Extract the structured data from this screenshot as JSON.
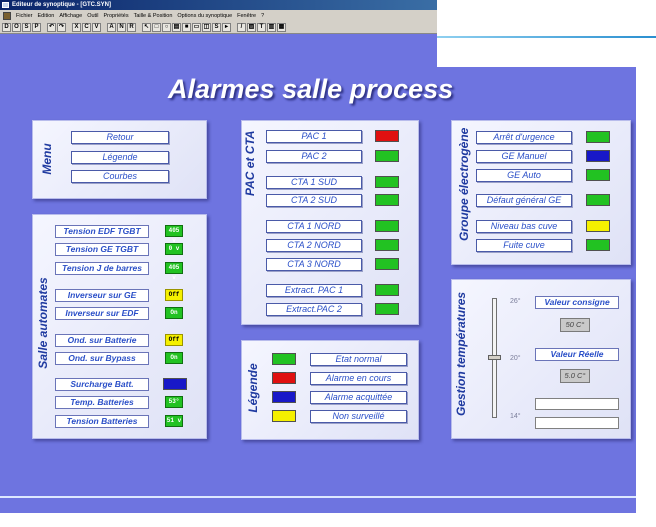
{
  "window": {
    "title": "Editeur de synoptique - [GTC.SYN]"
  },
  "menu": [
    "Fichier",
    "Edition",
    "Affichage",
    "Outil",
    "Propriétés",
    "Taille & Position",
    "Options du synoptique",
    "Fenêtre",
    "?"
  ],
  "toolbar_glyphs": [
    "D",
    "O",
    "S",
    "P",
    "",
    "↶",
    "↷",
    "",
    "X",
    "C",
    "V",
    "",
    "A",
    "N",
    "R",
    "",
    "↖",
    "□",
    "○",
    "▤",
    "■",
    "▭",
    "◫",
    "S",
    "▸",
    "",
    "/",
    "▨",
    "T",
    "▥",
    "▦"
  ],
  "page_title": "Alarmes salle process",
  "colors": {
    "green": "#22c222",
    "red": "#e01010",
    "blue": "#1818c8",
    "yellow": "#f5f000",
    "background": "#6e74e0"
  },
  "menu_panel": {
    "label": "Menu",
    "buttons": [
      "Retour",
      "Légende",
      "Courbes"
    ]
  },
  "salle_automates": {
    "label": "Salle automates",
    "rows": [
      {
        "label": "Tension EDF TGBT",
        "value": "405 v",
        "color": "green"
      },
      {
        "label": "Tension GE TGBT",
        "value": "0 v",
        "color": "green"
      },
      {
        "label": "Tension J de barres",
        "value": "405 v",
        "color": "green"
      },
      {
        "label": "Inverseur sur GE",
        "value": "Off",
        "color": "yellow"
      },
      {
        "label": "Inverseur sur EDF",
        "value": "On",
        "color": "green"
      },
      {
        "label": "Ond. sur Batterie",
        "value": "Off",
        "color": "yellow"
      },
      {
        "label": "Ond. sur Bypass",
        "value": "On",
        "color": "green"
      },
      {
        "label": "Surcharge Batt.",
        "value": "",
        "color": "blue"
      },
      {
        "label": "Temp. Batteries",
        "value": "53°",
        "color": "green"
      },
      {
        "label": "Tension Batteries",
        "value": "51 v",
        "color": "green"
      }
    ]
  },
  "pac_cta": {
    "label": "PAC et CTA",
    "rows": [
      {
        "label": "PAC 1",
        "color": "red"
      },
      {
        "label": "PAC 2",
        "color": "green"
      },
      {
        "label": "CTA 1 SUD",
        "color": "green"
      },
      {
        "label": "CTA 2 SUD",
        "color": "green"
      },
      {
        "label": "CTA 1 NORD",
        "color": "green"
      },
      {
        "label": "CTA 2 NORD",
        "color": "green"
      },
      {
        "label": "CTA 3 NORD",
        "color": "green"
      },
      {
        "label": "Extract. PAC 1",
        "color": "green"
      },
      {
        "label": "Extract.PAC 2",
        "color": "green"
      }
    ]
  },
  "legende": {
    "label": "Légende",
    "rows": [
      {
        "label": "Etat normal",
        "color": "green"
      },
      {
        "label": "Alarme en cours",
        "color": "red"
      },
      {
        "label": "Alarme acquittée",
        "color": "blue"
      },
      {
        "label": "Non surveillé",
        "color": "yellow"
      }
    ]
  },
  "groupe_electrogene": {
    "label": "Groupe électrogène",
    "rows": [
      {
        "label": "Arrêt d'urgence",
        "color": "green"
      },
      {
        "label": "GE Manuel",
        "color": "blue"
      },
      {
        "label": "GE Auto",
        "color": "green"
      },
      {
        "label": "Défaut général GE",
        "color": "green"
      },
      {
        "label": "Niveau bas cuve",
        "color": "yellow"
      },
      {
        "label": "Fuite cuve",
        "color": "green"
      }
    ]
  },
  "gestion_temperatures": {
    "label": "Gestion températures",
    "scale": {
      "top": "26°",
      "mid": "20°",
      "bottom": "14°"
    },
    "slider_value": 0.5,
    "consigne_label": "Valeur consigne",
    "consigne_value": "50 C°",
    "reelle_label": "Valeur Réelle",
    "reelle_value": "5.0 C°"
  }
}
